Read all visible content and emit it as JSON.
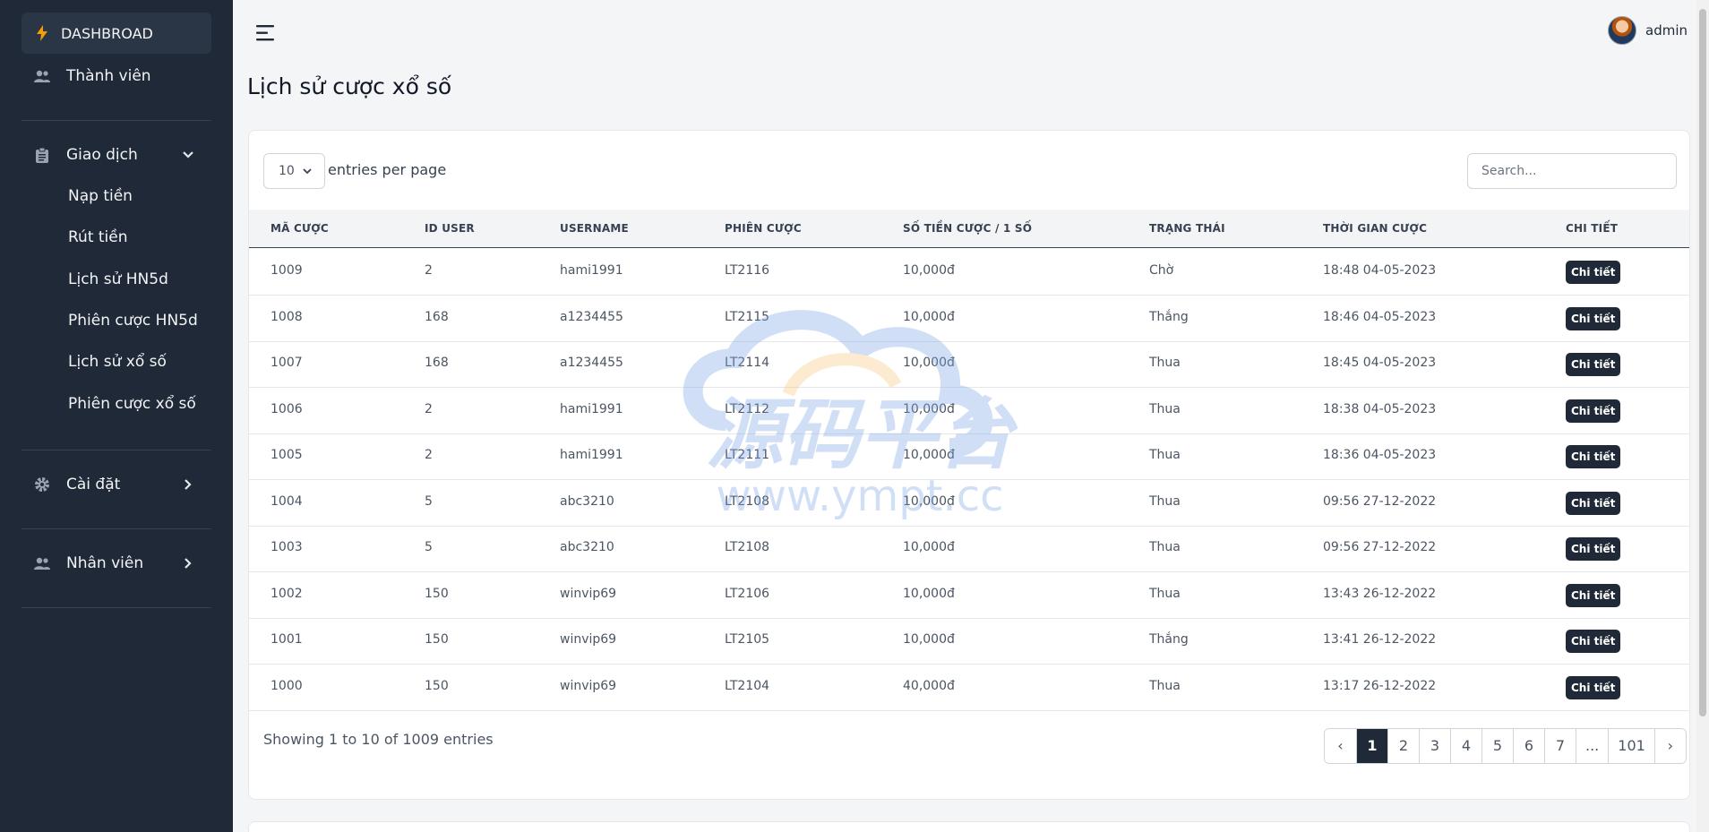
{
  "sidebar": {
    "dashboard": "DASHBROAD",
    "members": "Thành viên",
    "transactions": "Giao dịch",
    "sub_items": [
      "Nạp tiền",
      "Rút tiền",
      "Lịch sử HN5d",
      "Phiên cược HN5d",
      "Lịch sử xổ số",
      "Phiên cược xổ số"
    ],
    "settings": "Cài đặt",
    "staff": "Nhân viên"
  },
  "header": {
    "user": "admin"
  },
  "page": {
    "title": "Lịch sử cược xổ số"
  },
  "table_controls": {
    "per_page": "10",
    "per_page_label": "entries per page",
    "search_placeholder": "Search..."
  },
  "table": {
    "columns": [
      "Mã cược",
      "ID user",
      "Username",
      "Phiên cược",
      "Số tiền cược / 1 số",
      "Trạng thái",
      "Thời gian cược",
      "Chi tiết"
    ],
    "detail_label": "Chi tiết",
    "rows": [
      [
        "1009",
        "2",
        "hami1991",
        "LT2116",
        "10,000đ",
        "Chờ",
        "18:48 04-05-2023"
      ],
      [
        "1008",
        "168",
        "a1234455",
        "LT2115",
        "10,000đ",
        "Thắng",
        "18:46 04-05-2023"
      ],
      [
        "1007",
        "168",
        "a1234455",
        "LT2114",
        "10,000đ",
        "Thua",
        "18:45 04-05-2023"
      ],
      [
        "1006",
        "2",
        "hami1991",
        "LT2112",
        "10,000đ",
        "Thua",
        "18:38 04-05-2023"
      ],
      [
        "1005",
        "2",
        "hami1991",
        "LT2111",
        "10,000đ",
        "Thua",
        "18:36 04-05-2023"
      ],
      [
        "1004",
        "5",
        "abc3210",
        "LT2108",
        "10,000đ",
        "Thua",
        "09:56 27-12-2022"
      ],
      [
        "1003",
        "5",
        "abc3210",
        "LT2108",
        "10,000đ",
        "Thua",
        "09:56 27-12-2022"
      ],
      [
        "1002",
        "150",
        "winvip69",
        "LT2106",
        "10,000đ",
        "Thua",
        "13:43 26-12-2022"
      ],
      [
        "1001",
        "150",
        "winvip69",
        "LT2105",
        "10,000đ",
        "Thắng",
        "13:41 26-12-2022"
      ],
      [
        "1000",
        "150",
        "winvip69",
        "LT2104",
        "40,000đ",
        "Thua",
        "13:17 26-12-2022"
      ]
    ]
  },
  "footer": {
    "info": "Showing 1 to 10 of 1009 entries",
    "pages": [
      "‹",
      "1",
      "2",
      "3",
      "4",
      "5",
      "6",
      "7",
      "...",
      "101",
      "›"
    ],
    "active_page": "1"
  },
  "watermark": {
    "text_cn": "源码平台",
    "text_url": "www.ympt.cc"
  },
  "colors": {
    "sidebar_bg": "#1f2937",
    "accent_dark": "#1f2937",
    "bolt": "#f59e0b"
  },
  "icons": [
    "bolt-icon",
    "users-icon",
    "clipboard-icon",
    "gear-icon",
    "menu-icon",
    "chevron-down-icon",
    "chevron-right-icon"
  ]
}
